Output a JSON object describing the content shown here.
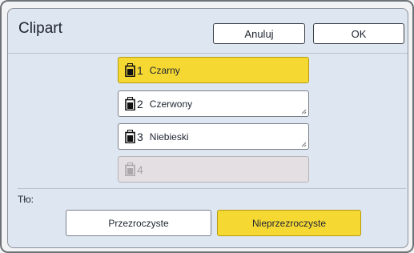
{
  "dialog": {
    "title": "Clipart",
    "cancel_label": "Anuluj",
    "ok_label": "OK"
  },
  "colors": [
    {
      "number": "1",
      "label": "Czarny",
      "state": "selected"
    },
    {
      "number": "2",
      "label": "Czerwony",
      "state": "normal"
    },
    {
      "number": "3",
      "label": "Niebieski",
      "state": "normal"
    },
    {
      "number": "4",
      "label": "",
      "state": "disabled"
    }
  ],
  "background": {
    "label": "Tło:",
    "options": [
      {
        "label": "Przezroczyste",
        "selected": false
      },
      {
        "label": "Nieprzezroczyste",
        "selected": true
      }
    ]
  },
  "accent_color": "#f6d833",
  "icons": {
    "drum": "ink-drum-icon"
  }
}
